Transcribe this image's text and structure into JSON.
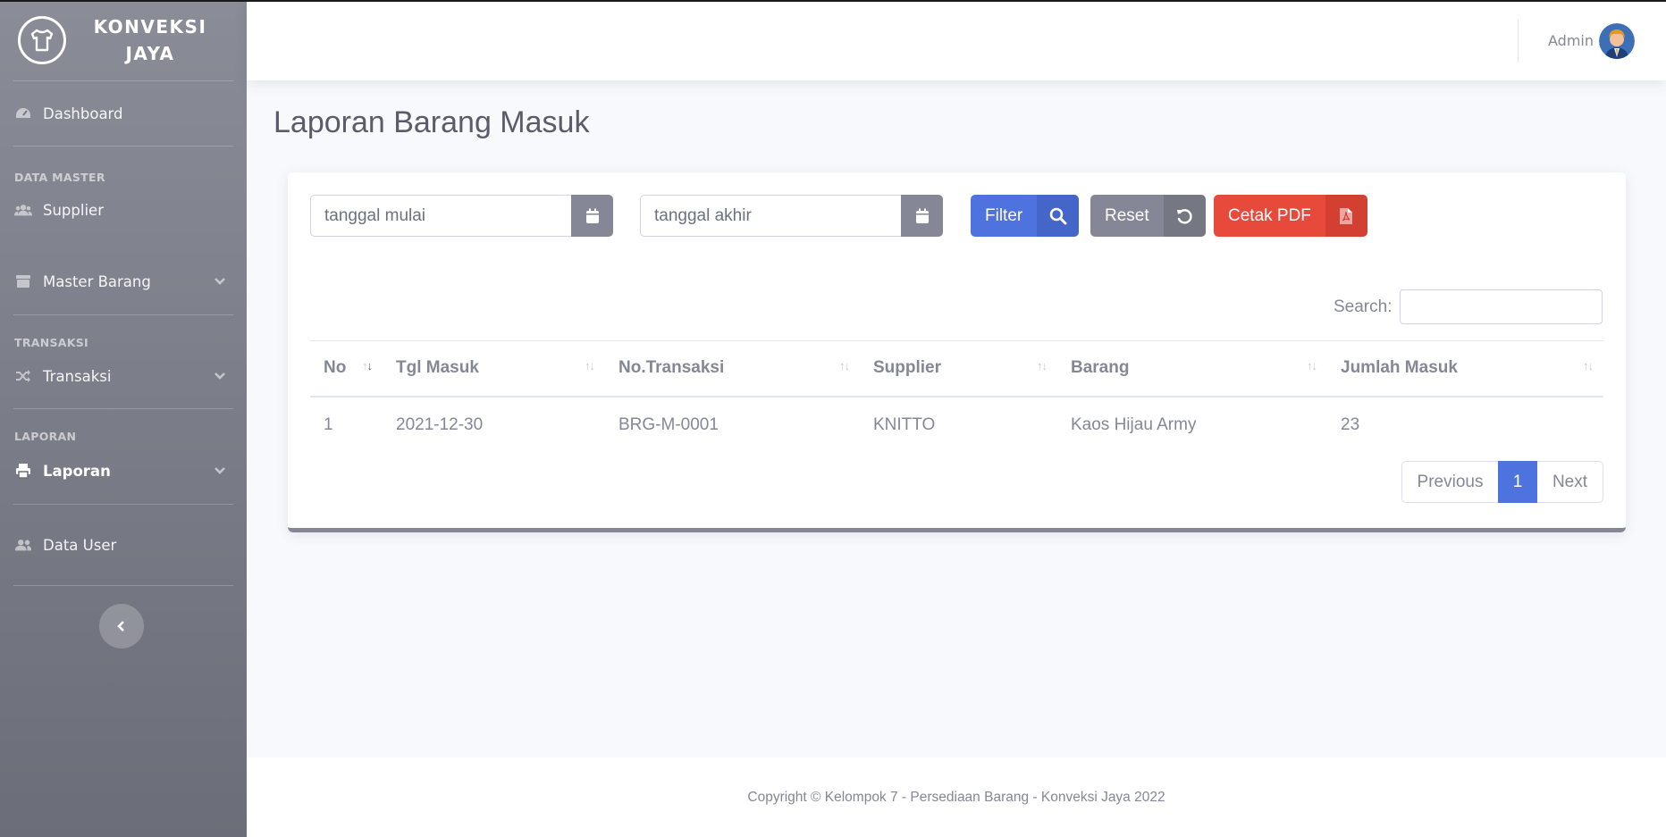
{
  "brand": {
    "line1": "KONVEKSI",
    "line2": "JAYA",
    "logo_icon": "tshirt-logo-icon"
  },
  "sidebar": {
    "items": [
      {
        "label": "Dashboard",
        "icon": "tachometer-icon"
      },
      {
        "heading": "DATA MASTER"
      },
      {
        "label": "Supplier",
        "icon": "users-icon"
      },
      {
        "label": "Master Barang",
        "icon": "box-icon",
        "has_chevron": true
      },
      {
        "heading": "TRANSAKSI"
      },
      {
        "label": "Transaksi",
        "icon": "random-icon",
        "has_chevron": true
      },
      {
        "heading": "LAPORAN"
      },
      {
        "label": "Laporan",
        "icon": "print-icon",
        "has_chevron": true,
        "active": true
      },
      {
        "label": "Data User",
        "icon": "user-group-icon"
      }
    ],
    "toggle_icon": "chevron-left-icon"
  },
  "topbar": {
    "username": "Admin"
  },
  "page": {
    "title": "Laporan Barang Masuk"
  },
  "filters": {
    "start_placeholder": "tanggal mulai",
    "end_placeholder": "tanggal akhir",
    "filter_label": "Filter",
    "reset_label": "Reset",
    "pdf_label": "Cetak PDF"
  },
  "search": {
    "label": "Search:"
  },
  "table": {
    "columns": [
      "No",
      "Tgl Masuk",
      "No.Transaksi",
      "Supplier",
      "Barang",
      "Jumlah Masuk"
    ],
    "rows": [
      [
        "1",
        "2021-12-30",
        "BRG-M-0001",
        "KNITTO",
        "Kaos Hijau Army",
        "23"
      ]
    ]
  },
  "pagination": {
    "previous": "Previous",
    "current": "1",
    "next": "Next"
  },
  "footer": {
    "text": "Copyright © Kelompok 7 - Persediaan Barang - Konveksi Jaya 2022"
  },
  "colors": {
    "primary": "#4e73df",
    "secondary": "#858796",
    "danger": "#e74a3b"
  }
}
